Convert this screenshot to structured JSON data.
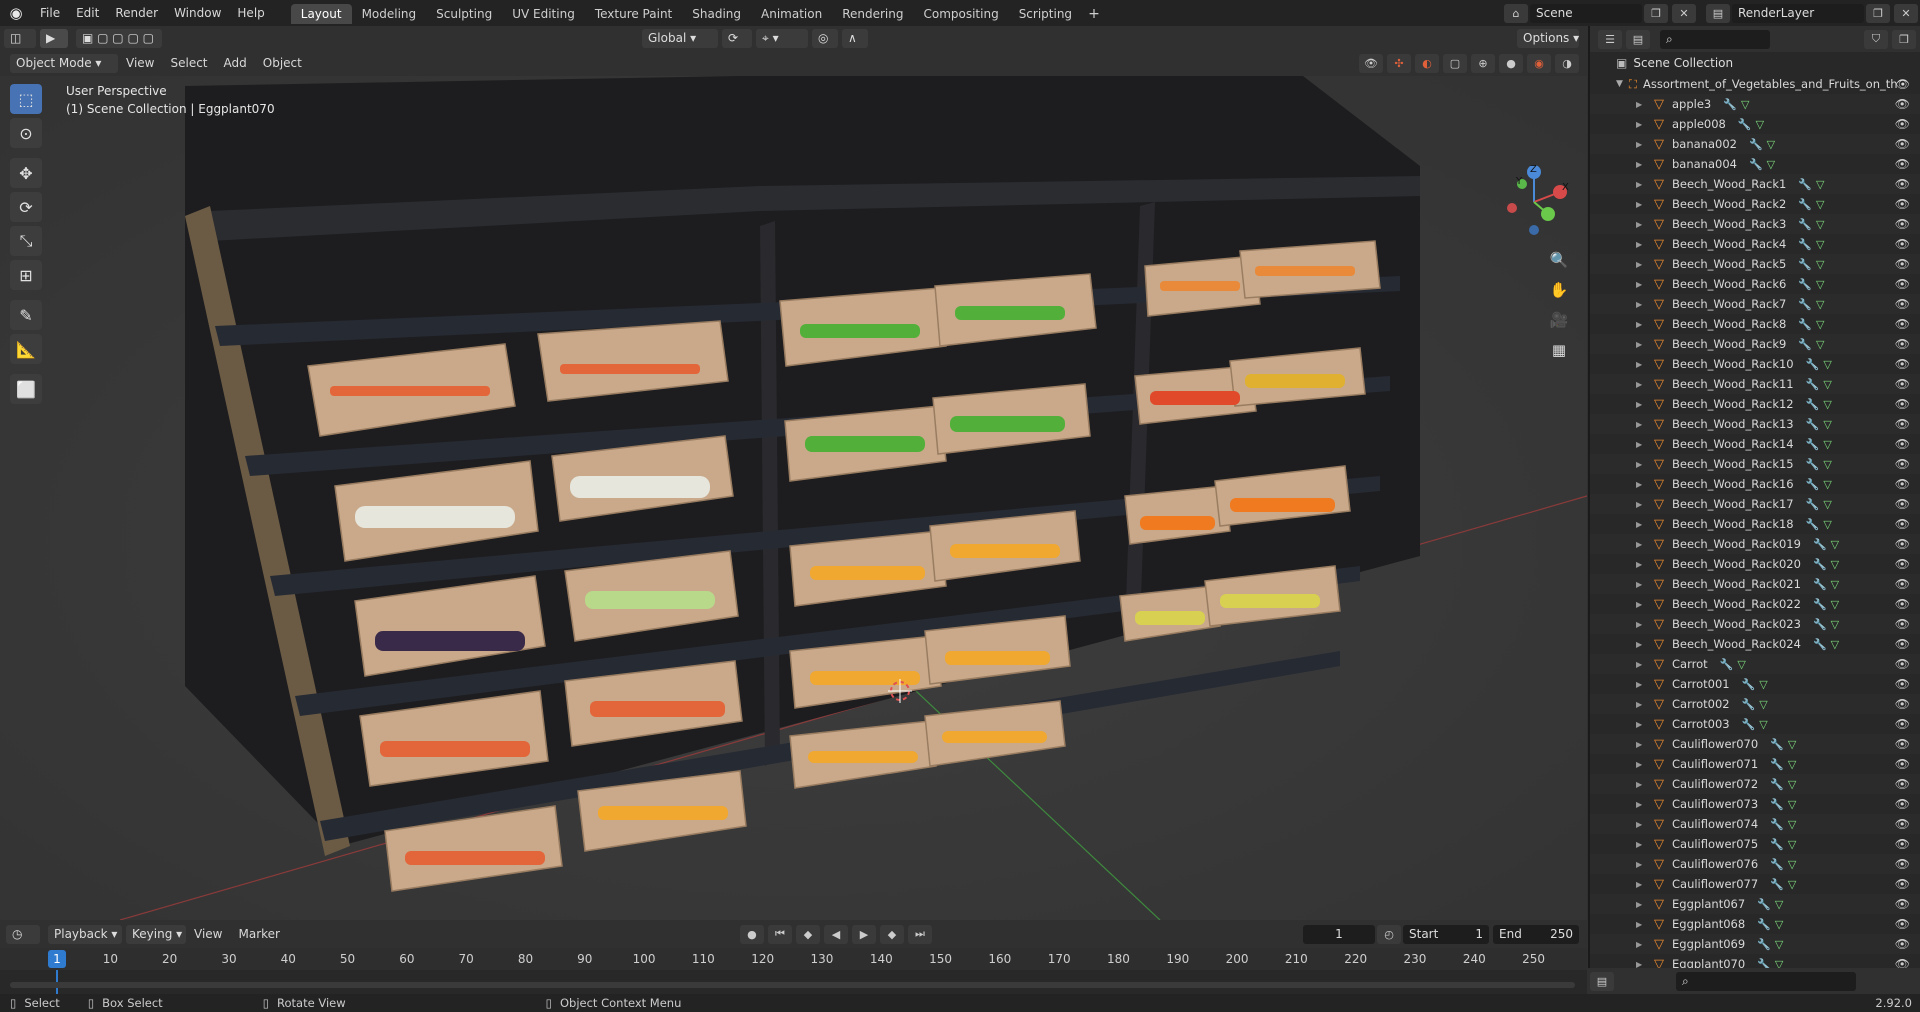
{
  "topbar": {
    "menus": [
      "File",
      "Edit",
      "Render",
      "Window",
      "Help"
    ],
    "workspaces": [
      "Layout",
      "Modeling",
      "Sculpting",
      "UV Editing",
      "Texture Paint",
      "Shading",
      "Animation",
      "Rendering",
      "Compositing",
      "Scripting"
    ],
    "active_workspace": "Layout",
    "plus": "+",
    "scene": "Scene",
    "render_layer": "RenderLayer"
  },
  "viewport_header": {
    "mode": "Object Mode",
    "menus": [
      "View",
      "Select",
      "Add",
      "Object"
    ],
    "transform": "Global",
    "options": "Options"
  },
  "viewport": {
    "perspective": "User Perspective",
    "context": "(1) Scene Collection | Eggplant070"
  },
  "gizmo": {
    "x": "X",
    "y": "Y",
    "z": "Z"
  },
  "outliner": {
    "root": "Scene Collection",
    "collection": "Assortment_of_Vegetables_and_Fruits_on_th",
    "items": [
      "apple3",
      "apple008",
      "banana002",
      "banana004",
      "Beech_Wood_Rack1",
      "Beech_Wood_Rack2",
      "Beech_Wood_Rack3",
      "Beech_Wood_Rack4",
      "Beech_Wood_Rack5",
      "Beech_Wood_Rack6",
      "Beech_Wood_Rack7",
      "Beech_Wood_Rack8",
      "Beech_Wood_Rack9",
      "Beech_Wood_Rack10",
      "Beech_Wood_Rack11",
      "Beech_Wood_Rack12",
      "Beech_Wood_Rack13",
      "Beech_Wood_Rack14",
      "Beech_Wood_Rack15",
      "Beech_Wood_Rack16",
      "Beech_Wood_Rack17",
      "Beech_Wood_Rack18",
      "Beech_Wood_Rack019",
      "Beech_Wood_Rack020",
      "Beech_Wood_Rack021",
      "Beech_Wood_Rack022",
      "Beech_Wood_Rack023",
      "Beech_Wood_Rack024",
      "Carrot",
      "Carrot001",
      "Carrot002",
      "Carrot003",
      "Cauliflower070",
      "Cauliflower071",
      "Cauliflower072",
      "Cauliflower073",
      "Cauliflower074",
      "Cauliflower075",
      "Cauliflower076",
      "Cauliflower077",
      "Eggplant067",
      "Eggplant068",
      "Eggplant069",
      "Eggplant070"
    ]
  },
  "timeline": {
    "menus": [
      "Playback",
      "Keying",
      "View",
      "Marker"
    ],
    "current_frame": "1",
    "start_label": "Start",
    "start": "1",
    "end_label": "End",
    "end": "250",
    "ticks": [
      "10",
      "20",
      "30",
      "40",
      "50",
      "60",
      "70",
      "80",
      "90",
      "100",
      "110",
      "120",
      "130",
      "140",
      "150",
      "160",
      "170",
      "180",
      "190",
      "200",
      "210",
      "220",
      "230",
      "240",
      "250"
    ],
    "cursor": "1"
  },
  "statusbar": {
    "select": "Select",
    "box_select": "Box Select",
    "rotate": "Rotate View",
    "context_menu": "Object Context Menu",
    "version": "2.92.0"
  }
}
